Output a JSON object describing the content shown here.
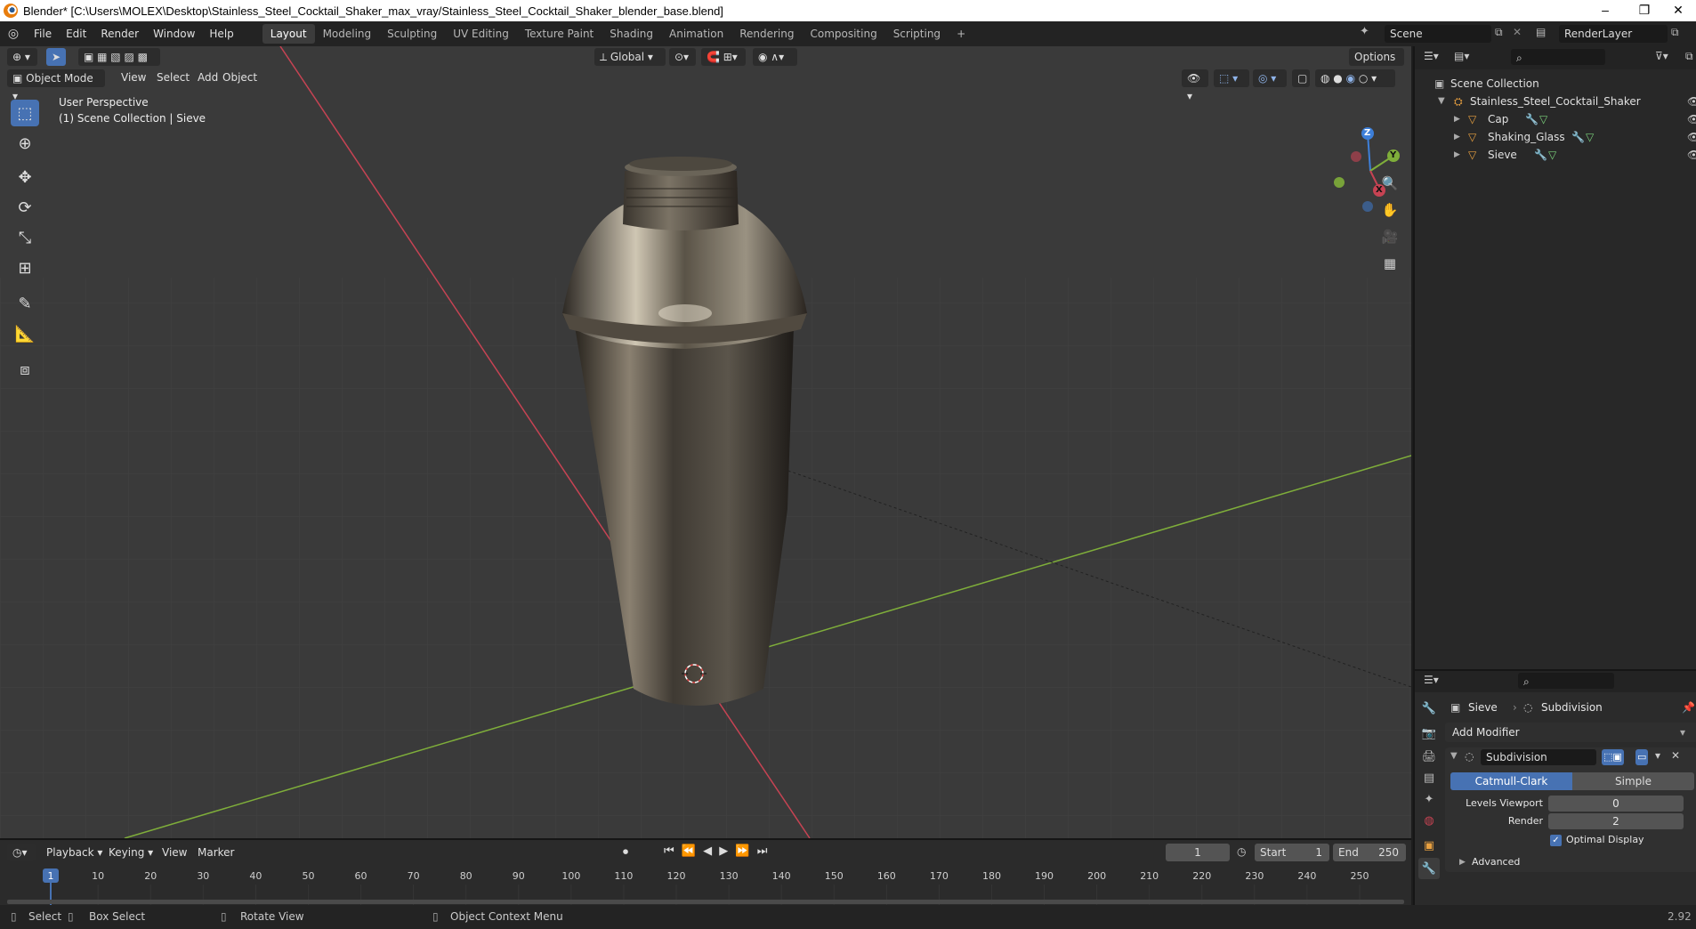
{
  "window": {
    "title": "Blender* [C:\\Users\\MOLEX\\Desktop\\Stainless_Steel_Cocktail_Shaker_max_vray/Stainless_Steel_Cocktail_Shaker_blender_base.blend]",
    "minimize": "–",
    "restore": "❐",
    "close": "✕"
  },
  "menu": [
    "File",
    "Edit",
    "Render",
    "Window",
    "Help"
  ],
  "workspaces": [
    "Layout",
    "Modeling",
    "Sculpting",
    "UV Editing",
    "Texture Paint",
    "Shading",
    "Animation",
    "Rendering",
    "Compositing",
    "Scripting"
  ],
  "workspace_add": "+",
  "scene": {
    "name": "Scene",
    "render_layer": "RenderLayer"
  },
  "viewport": {
    "transform_orientation": "Global",
    "options_label": "Options",
    "mode": "Object Mode",
    "menus": [
      "View",
      "Select",
      "Add",
      "Object"
    ],
    "perspective_label": "User Perspective",
    "collection_label": "(1) Scene Collection | Sieve",
    "gizmo": {
      "z": "Z",
      "y": "Y",
      "x": "X"
    }
  },
  "outliner": {
    "root": "Scene Collection",
    "collection": "Stainless_Steel_Cocktail_Shaker",
    "objects": [
      "Cap",
      "Shaking_Glass",
      "Sieve"
    ]
  },
  "properties": {
    "object_name": "Sieve",
    "modifier_breadcrumb": "Subdivision",
    "add_modifier": "Add Modifier",
    "modifier_name": "Subdivision",
    "algorithm_options": [
      "Catmull-Clark",
      "Simple"
    ],
    "algorithm_selected": "Catmull-Clark",
    "levels_viewport_label": "Levels Viewport",
    "levels_viewport_value": "0",
    "render_label": "Render",
    "render_value": "2",
    "optimal_display_label": "Optimal Display",
    "optimal_display_checked": true,
    "advanced_label": "Advanced"
  },
  "timeline": {
    "menus": [
      "Playback",
      "Keying",
      "View",
      "Marker"
    ],
    "current_frame": "1",
    "start_label": "Start",
    "start_value": "1",
    "end_label": "End",
    "end_value": "250",
    "ruler": [
      "1",
      "10",
      "20",
      "30",
      "40",
      "50",
      "60",
      "70",
      "80",
      "90",
      "100",
      "110",
      "120",
      "130",
      "140",
      "150",
      "160",
      "170",
      "180",
      "190",
      "200",
      "210",
      "220",
      "230",
      "240",
      "250"
    ]
  },
  "statusbar": {
    "select": "Select",
    "box_select": "Box Select",
    "rotate_view": "Rotate View",
    "context_menu": "Object Context Menu",
    "version": "2.92"
  },
  "colors": {
    "accent": "#4772b3",
    "x_axis": "#c64353",
    "y_axis": "#7fae3a",
    "z_axis": "#3d7fd9",
    "playhead": "#4772b3"
  }
}
